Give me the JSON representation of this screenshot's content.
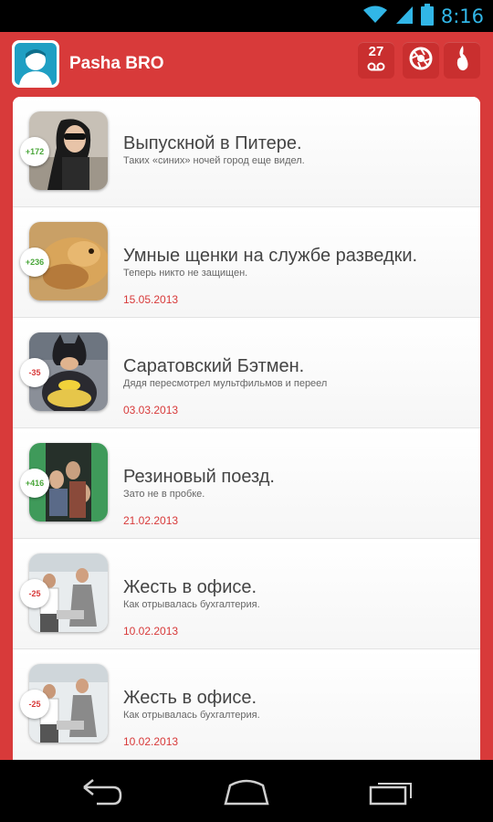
{
  "status_bar": {
    "time": "8:16",
    "icons": [
      "wifi-icon",
      "signal-icon",
      "battery-icon"
    ],
    "time_color": "#31b6e7"
  },
  "header": {
    "user_name": "Pasha BRO",
    "notifications_count": "27",
    "icons": [
      "avatar",
      "voicemail-icon",
      "camera-shutter-icon",
      "flame-icon"
    ],
    "brand_color": "#d83a3a"
  },
  "feed": {
    "items": [
      {
        "score": "+172",
        "title": "Выпускной в Питере.",
        "subtitle": "Таких «синих» ночей город еще видел.",
        "date": ""
      },
      {
        "score": "+236",
        "title": "Умные щенки на службе разведки.",
        "subtitle": "Теперь никто не защищен.",
        "date": "15.05.2013"
      },
      {
        "score": "-35",
        "title": "Саратовский Бэтмен.",
        "subtitle": "Дядя пересмотрел мультфильмов и переел",
        "date": "03.03.2013"
      },
      {
        "score": "+416",
        "title": "Резиновый поезд.",
        "subtitle": "Зато не в пробке.",
        "date": "21.02.2013"
      },
      {
        "score": "-25",
        "title": "Жесть в офисе.",
        "subtitle": "Как отрывалась бухгалтерия.",
        "date": "10.02.2013"
      },
      {
        "score": "-25",
        "title": "Жесть в офисе.",
        "subtitle": "Как отрывалась бухгалтерия.",
        "date": "10.02.2013"
      }
    ]
  },
  "nav_bar": {
    "icons": [
      "back-icon",
      "home-icon",
      "recent-apps-icon"
    ]
  }
}
